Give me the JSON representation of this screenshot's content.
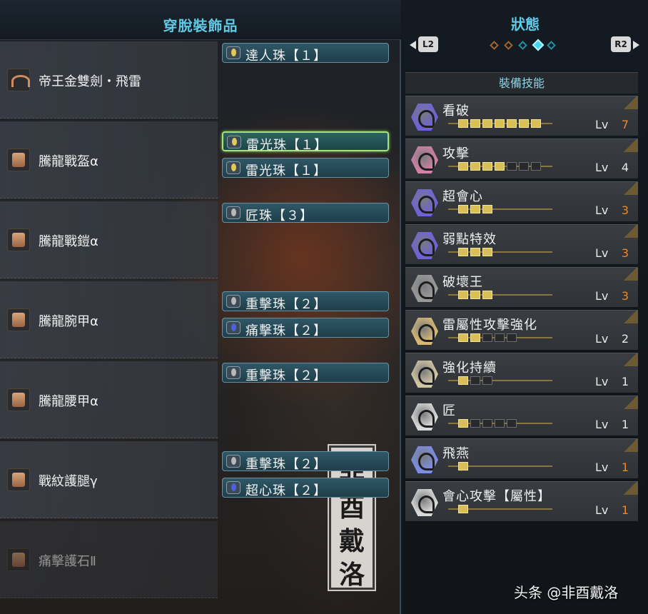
{
  "left_panel": {
    "title": "穿脫裝飾品",
    "equipment": [
      {
        "name": "帝王金雙劍・飛雷",
        "icon": "dual-blades-icon",
        "decorations": [
          {
            "name": "達人珠【１】",
            "color": "yellow",
            "selected": false
          }
        ]
      },
      {
        "name": "騰龍戰盔α",
        "icon": "helmet-icon",
        "decorations": [
          {
            "name": "雷光珠【１】",
            "color": "yellow",
            "selected": true
          },
          {
            "name": "雷光珠【１】",
            "color": "yellow",
            "selected": false
          }
        ]
      },
      {
        "name": "騰龍戰鎧α",
        "icon": "chest-armor-icon",
        "decorations": [
          {
            "name": "匠珠【３】",
            "color": "gray",
            "selected": false
          }
        ]
      },
      {
        "name": "騰龍腕甲α",
        "icon": "arm-armor-icon",
        "decorations": [
          {
            "name": "重擊珠【２】",
            "color": "gray",
            "selected": false
          },
          {
            "name": "痛擊珠【２】",
            "color": "blue",
            "selected": false
          }
        ]
      },
      {
        "name": "騰龍腰甲α",
        "icon": "waist-armor-icon",
        "decorations": [
          {
            "name": "重擊珠【２】",
            "color": "gray",
            "selected": false
          }
        ]
      },
      {
        "name": "戰紋護腿γ",
        "icon": "leg-armor-icon",
        "decorations": [
          {
            "name": "重擊珠【２】",
            "color": "gray",
            "selected": false
          },
          {
            "name": "超心珠【２】",
            "color": "blue",
            "selected": false
          }
        ]
      },
      {
        "name": "痛擊護石Ⅱ",
        "icon": "charm-icon",
        "decorations": []
      }
    ],
    "seal_text": [
      "非",
      "酉",
      "戴",
      "洛"
    ]
  },
  "right_panel": {
    "title": "狀態",
    "prev_button": "L2",
    "next_button": "R2",
    "page_count": 5,
    "active_page": 4,
    "section_title": "裝備技能",
    "level_prefix": "Lv",
    "skills": [
      {
        "name": "看破",
        "level": 7,
        "max": 7,
        "maxed": true,
        "icon_color": "#6f62d8"
      },
      {
        "name": "攻擊",
        "level": 4,
        "max": 7,
        "maxed": false,
        "icon_color": "#d37fa6"
      },
      {
        "name": "超會心",
        "level": 3,
        "max": 3,
        "maxed": true,
        "icon_color": "#6f62d8"
      },
      {
        "name": "弱點特效",
        "level": 3,
        "max": 3,
        "maxed": true,
        "icon_color": "#6f62d8"
      },
      {
        "name": "破壞王",
        "level": 3,
        "max": 3,
        "maxed": true,
        "icon_color": "#9a9a9a"
      },
      {
        "name": "雷屬性攻擊強化",
        "level": 2,
        "max": 5,
        "maxed": false,
        "icon_color": "#d8b873"
      },
      {
        "name": "強化持續",
        "level": 1,
        "max": 3,
        "maxed": false,
        "icon_color": "#d2c6a2"
      },
      {
        "name": "匠",
        "level": 1,
        "max": 5,
        "maxed": false,
        "icon_color": "#d9d9d9"
      },
      {
        "name": "飛燕",
        "level": 1,
        "max": 1,
        "maxed": true,
        "icon_color": "#7b8ee6"
      },
      {
        "name": "會心攻擊【屬性】",
        "level": 1,
        "max": 1,
        "maxed": true,
        "icon_color": "#d9d9d9"
      }
    ]
  },
  "colors": {
    "accent": "#5fc9e6",
    "maxed_level": "#e98a2c",
    "normal_level": "#e8e8e8"
  },
  "watermark": "头条 @非酉戴洛"
}
